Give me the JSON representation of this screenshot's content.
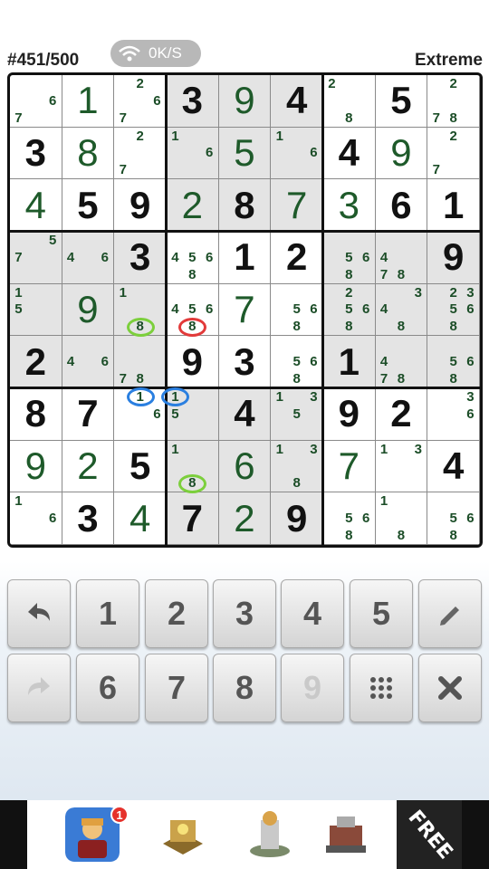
{
  "header": {
    "puzzle_number": "#451/500",
    "network_speed": "0K/S",
    "difficulty": "Extreme"
  },
  "board": {
    "shaded_boxes": [
      1,
      3,
      5,
      7
    ],
    "cells": [
      [
        {
          "c": [
            "6",
            "7"
          ],
          "cp": [
            5,
            6
          ]
        },
        {
          "v": "1",
          "t": "e"
        },
        {
          "c": [
            "2",
            "6",
            "7"
          ],
          "cp": [
            1,
            5,
            6
          ]
        },
        {
          "v": "3",
          "t": "g"
        },
        {
          "v": "9",
          "t": "e"
        },
        {
          "v": "4",
          "t": "g"
        },
        {
          "c": [
            "2",
            "8"
          ],
          "cp": [
            0,
            7
          ]
        },
        {
          "v": "5",
          "t": "g"
        },
        {
          "c": [
            "2",
            "7",
            "8"
          ],
          "cp": [
            1,
            6,
            7
          ]
        }
      ],
      [
        {
          "v": "3",
          "t": "g"
        },
        {
          "v": "8",
          "t": "e"
        },
        {
          "c": [
            "2",
            "7"
          ],
          "cp": [
            1,
            6
          ]
        },
        {
          "c": [
            "1",
            "6"
          ],
          "cp": [
            0,
            5
          ]
        },
        {
          "v": "5",
          "t": "e"
        },
        {
          "c": [
            "1",
            "6"
          ],
          "cp": [
            0,
            5
          ]
        },
        {
          "v": "4",
          "t": "g"
        },
        {
          "v": "9",
          "t": "e"
        },
        {
          "c": [
            "2",
            "7"
          ],
          "cp": [
            1,
            6
          ]
        }
      ],
      [
        {
          "v": "4",
          "t": "e"
        },
        {
          "v": "5",
          "t": "g"
        },
        {
          "v": "9",
          "t": "g"
        },
        {
          "v": "2",
          "t": "e"
        },
        {
          "v": "8",
          "t": "g"
        },
        {
          "v": "7",
          "t": "e"
        },
        {
          "v": "3",
          "t": "e"
        },
        {
          "v": "6",
          "t": "g"
        },
        {
          "v": "1",
          "t": "g"
        }
      ],
      [
        {
          "c": [
            "5",
            "7"
          ],
          "cp": [
            2,
            3
          ]
        },
        {
          "c": [
            "4",
            "6"
          ],
          "cp": [
            3,
            5
          ]
        },
        {
          "v": "3",
          "t": "g"
        },
        {
          "c": [
            "4",
            "5",
            "6",
            "8"
          ],
          "cp": [
            3,
            4,
            5,
            7
          ]
        },
        {
          "v": "1",
          "t": "g"
        },
        {
          "v": "2",
          "t": "g"
        },
        {
          "c": [
            "5",
            "6",
            "8"
          ],
          "cp": [
            4,
            5,
            7
          ]
        },
        {
          "c": [
            "4",
            "7",
            "8"
          ],
          "cp": [
            3,
            6,
            7
          ]
        },
        {
          "v": "9",
          "t": "g"
        }
      ],
      [
        {
          "c": [
            "1",
            "5"
          ],
          "cp": [
            0,
            3
          ]
        },
        {
          "v": "9",
          "t": "e"
        },
        {
          "c": [
            "1",
            "8"
          ],
          "cp": [
            0,
            7
          ]
        },
        {
          "c": [
            "4",
            "5",
            "6",
            "8"
          ],
          "cp": [
            3,
            4,
            5,
            7
          ]
        },
        {
          "v": "7",
          "t": "e"
        },
        {
          "c": [
            "5",
            "6",
            "8"
          ],
          "cp": [
            4,
            5,
            7
          ]
        },
        {
          "c": [
            "2",
            "5",
            "6",
            "8"
          ],
          "cp": [
            1,
            4,
            5,
            7
          ]
        },
        {
          "c": [
            "3",
            "4",
            "8"
          ],
          "cp": [
            2,
            3,
            7
          ]
        },
        {
          "c": [
            "2",
            "3",
            "5",
            "6",
            "8"
          ],
          "cp": [
            1,
            2,
            4,
            5,
            7
          ]
        }
      ],
      [
        {
          "v": "2",
          "t": "g"
        },
        {
          "c": [
            "4",
            "6"
          ],
          "cp": [
            3,
            5
          ]
        },
        {
          "c": [
            "7",
            "8"
          ],
          "cp": [
            6,
            7
          ]
        },
        {
          "v": "9",
          "t": "g"
        },
        {
          "v": "3",
          "t": "g"
        },
        {
          "c": [
            "5",
            "6",
            "8"
          ],
          "cp": [
            4,
            5,
            7
          ]
        },
        {
          "v": "1",
          "t": "g"
        },
        {
          "c": [
            "4",
            "7",
            "8"
          ],
          "cp": [
            3,
            6,
            7
          ]
        },
        {
          "c": [
            "5",
            "6",
            "8"
          ],
          "cp": [
            4,
            5,
            7
          ]
        }
      ],
      [
        {
          "v": "8",
          "t": "g"
        },
        {
          "v": "7",
          "t": "g"
        },
        {
          "c": [
            "1",
            "6"
          ],
          "cp": [
            1,
            5
          ]
        },
        {
          "c": [
            "1",
            "5"
          ],
          "cp": [
            0,
            3
          ]
        },
        {
          "v": "4",
          "t": "g"
        },
        {
          "c": [
            "1",
            "3",
            "5"
          ],
          "cp": [
            0,
            2,
            4
          ]
        },
        {
          "v": "9",
          "t": "g"
        },
        {
          "v": "2",
          "t": "g"
        },
        {
          "c": [
            "3",
            "6"
          ],
          "cp": [
            2,
            5
          ]
        }
      ],
      [
        {
          "v": "9",
          "t": "e"
        },
        {
          "v": "2",
          "t": "e"
        },
        {
          "v": "5",
          "t": "g"
        },
        {
          "c": [
            "1",
            "8"
          ],
          "cp": [
            0,
            7
          ]
        },
        {
          "v": "6",
          "t": "e"
        },
        {
          "c": [
            "1",
            "3",
            "8"
          ],
          "cp": [
            0,
            2,
            7
          ]
        },
        {
          "v": "7",
          "t": "e"
        },
        {
          "c": [
            "1",
            "3"
          ],
          "cp": [
            0,
            2
          ]
        },
        {
          "v": "4",
          "t": "g"
        }
      ],
      [
        {
          "c": [
            "1",
            "6"
          ],
          "cp": [
            0,
            5
          ]
        },
        {
          "v": "3",
          "t": "g"
        },
        {
          "v": "4",
          "t": "e"
        },
        {
          "v": "7",
          "t": "g"
        },
        {
          "v": "2",
          "t": "e"
        },
        {
          "v": "9",
          "t": "g"
        },
        {
          "c": [
            "5",
            "6",
            "8"
          ],
          "cp": [
            4,
            5,
            7
          ]
        },
        {
          "c": [
            "1",
            "8"
          ],
          "cp": [
            0,
            7
          ]
        },
        {
          "c": [
            "5",
            "6",
            "8"
          ],
          "cp": [
            4,
            5,
            7
          ]
        }
      ]
    ],
    "highlight_marks": [
      {
        "row": 4,
        "col": 2,
        "cand": 7,
        "color": "#7ccf3c"
      },
      {
        "row": 4,
        "col": 3,
        "cand": 7,
        "color": "#e23a3a"
      },
      {
        "row": 6,
        "col": 2,
        "cand": 1,
        "color": "#2a7fe0"
      },
      {
        "row": 6,
        "col": 3,
        "cand": 0,
        "color": "#2a7fe0"
      },
      {
        "row": 7,
        "col": 3,
        "cand": 7,
        "color": "#7ccf3c"
      }
    ]
  },
  "keypad": {
    "row1": [
      {
        "label": "",
        "icon": "undo-icon"
      },
      {
        "label": "1"
      },
      {
        "label": "2"
      },
      {
        "label": "3"
      },
      {
        "label": "4"
      },
      {
        "label": "5"
      },
      {
        "label": "",
        "icon": "pencil-icon"
      }
    ],
    "row2": [
      {
        "label": "",
        "icon": "redo-icon",
        "disabled": true
      },
      {
        "label": "6"
      },
      {
        "label": "7"
      },
      {
        "label": "8"
      },
      {
        "label": "9",
        "disabled": true
      },
      {
        "label": "",
        "icon": "grid-dots-icon"
      },
      {
        "label": "",
        "icon": "close-icon"
      }
    ]
  },
  "ad": {
    "badge_count": "1",
    "free_label": "FREE",
    "apps": [
      "ad-app-fighter-icon",
      "ad-app-treasure-icon",
      "ad-app-tower-icon",
      "ad-app-robot-icon"
    ]
  },
  "colors": {
    "given_digit": "#111111",
    "entered_digit": "#1e5a2a",
    "candidate": "#1b4d27",
    "shade": "#e4e4e4"
  }
}
